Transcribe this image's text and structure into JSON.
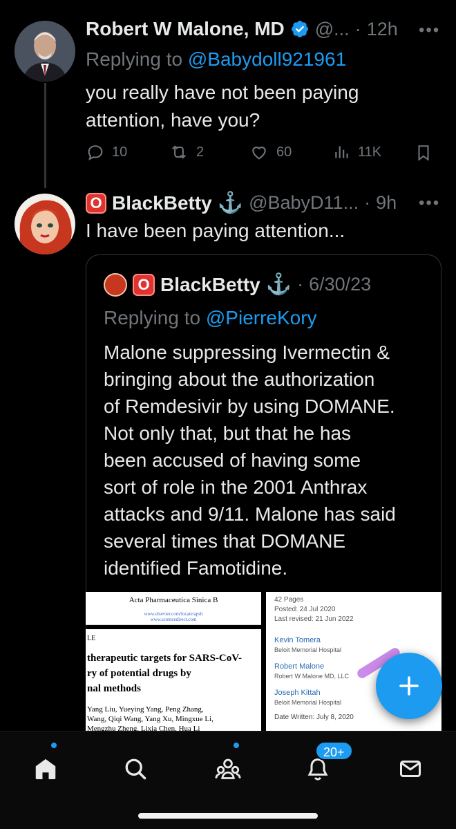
{
  "tweet1": {
    "name": "Robert W Malone, MD",
    "handle": "@...",
    "dot": "·",
    "time": "12h",
    "replying_prefix": "Replying to",
    "replying_handle": "@Babydoll921961",
    "text_line1": "you really have not been paying",
    "text_line2": "attention, have you?",
    "replies": "10",
    "retweets": "2",
    "likes": "60",
    "views": "11K"
  },
  "tweet2": {
    "name": "BlackBetty",
    "emoji_stop": "O",
    "anchor": "⚓",
    "handle": "@BabyD11...",
    "dot": "·",
    "time": "9h",
    "text": "I have been paying attention..."
  },
  "quote": {
    "name": "BlackBetty",
    "emoji_stop": "O",
    "anchor": "⚓",
    "dot": "·",
    "date": "6/30/23",
    "replying_prefix": "Replying to",
    "replying_handle": "@PierreKory",
    "lines": [
      "Malone suppressing Ivermectin &",
      "bringing about the authorization",
      "of Remdesivir by using DOMANE.",
      "Not only that, but that he has",
      "been accused of having some",
      "sort of role in the 2001 Anthrax",
      "attacks and 9/11. Malone has said",
      "several times that DOMANE",
      "identified Famotidine."
    ]
  },
  "paper_left": {
    "journal": "Acta Pharmaceutica Sinica B",
    "url1": "www.elsevier.com/locate/apsb",
    "url2": "www.sciencedirect.com",
    "tag": "LE",
    "title1": "therapeutic targets for SARS-CoV-",
    "title2": "ry of potential drugs by",
    "title3": "nal methods",
    "authors1": "Yang Liu, Yueying Yang, Peng Zhang,",
    "authors2": "Wang, Qiqi Wang, Yang Xu, Mingxue Li,",
    "authors3": "Mengzhu Zheng, Lixia Chen, Hua Li"
  },
  "paper_right": {
    "pages": "42 Pages",
    "posted": "Posted: 24 Jul 2020",
    "revised": "Last revised: 21 Jun 2022",
    "author1": "Kevin Tomera",
    "affil1": "Beloit Memorial Hospital",
    "author2": "Robert Malone",
    "affil2": "Robert W Malone MD, LLC",
    "author3": "Joseph Kittah",
    "affil3": "Beloit Memorial Hospital",
    "written": "Date Written: July 8, 2020"
  },
  "nav": {
    "notifications_badge": "20+"
  },
  "colors": {
    "accent": "#1d9bf0",
    "muted": "#71767b",
    "text": "#e7e9ea",
    "background": "#000000"
  },
  "icons": [
    "verified-icon",
    "more-icon",
    "reply-icon",
    "retweet-icon",
    "like-icon",
    "views-icon",
    "bookmark-icon",
    "home-icon",
    "search-icon",
    "communities-icon",
    "notifications-icon",
    "messages-icon",
    "compose-icon"
  ]
}
